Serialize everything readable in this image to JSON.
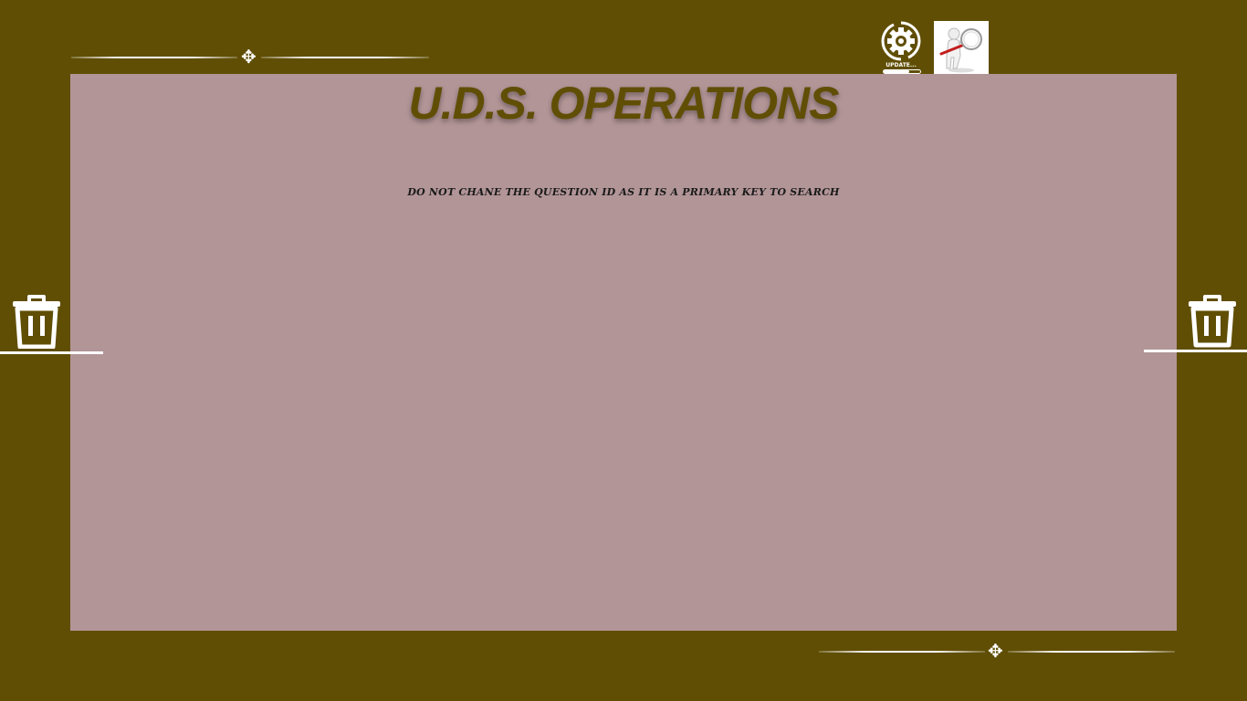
{
  "title": "U.D.S. OPERATIONS",
  "warning": "DO NOT CHANE THE QUESTION ID AS IT IS A PRIMARY KEY TO SEARCH",
  "update": {
    "label": "UPDATE..."
  },
  "icons": {
    "update": "gear-update-icon",
    "search": "magnifier-figure-icon",
    "delete": "trash-icon",
    "ornament": "fleuron-icon"
  },
  "colors": {
    "background": "#604e05",
    "panel": "#b29597",
    "title": "#604e05"
  }
}
